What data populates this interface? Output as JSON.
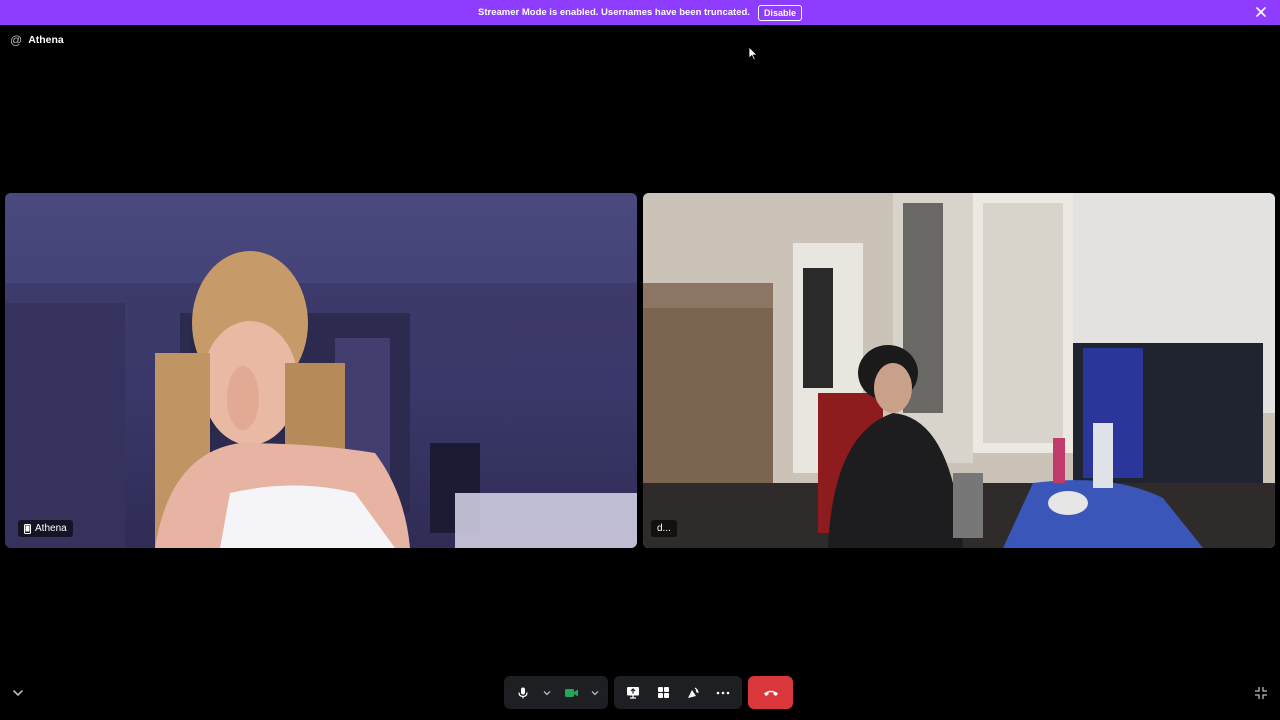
{
  "banner": {
    "message": "Streamer Mode is enabled. Usernames have been truncated.",
    "disable_label": "Disable",
    "color": "#8e3dff"
  },
  "channel": {
    "name": "Athena",
    "icon": "at-icon"
  },
  "participants": [
    {
      "name": "Athena",
      "device_icon": "mobile-phone-icon",
      "speaking": false
    },
    {
      "name": "d...",
      "speaking": true,
      "speaking_color": "#3ba55d"
    }
  ],
  "controls": {
    "icons": [
      "microphone-icon",
      "chevron-down-icon",
      "camera-icon",
      "chevron-down-icon",
      "screen-share-icon",
      "activities-icon",
      "soundboard-icon",
      "more-icon",
      "end-call-icon"
    ],
    "camera_color": "#23a55a",
    "end_call_color": "#da373c"
  }
}
